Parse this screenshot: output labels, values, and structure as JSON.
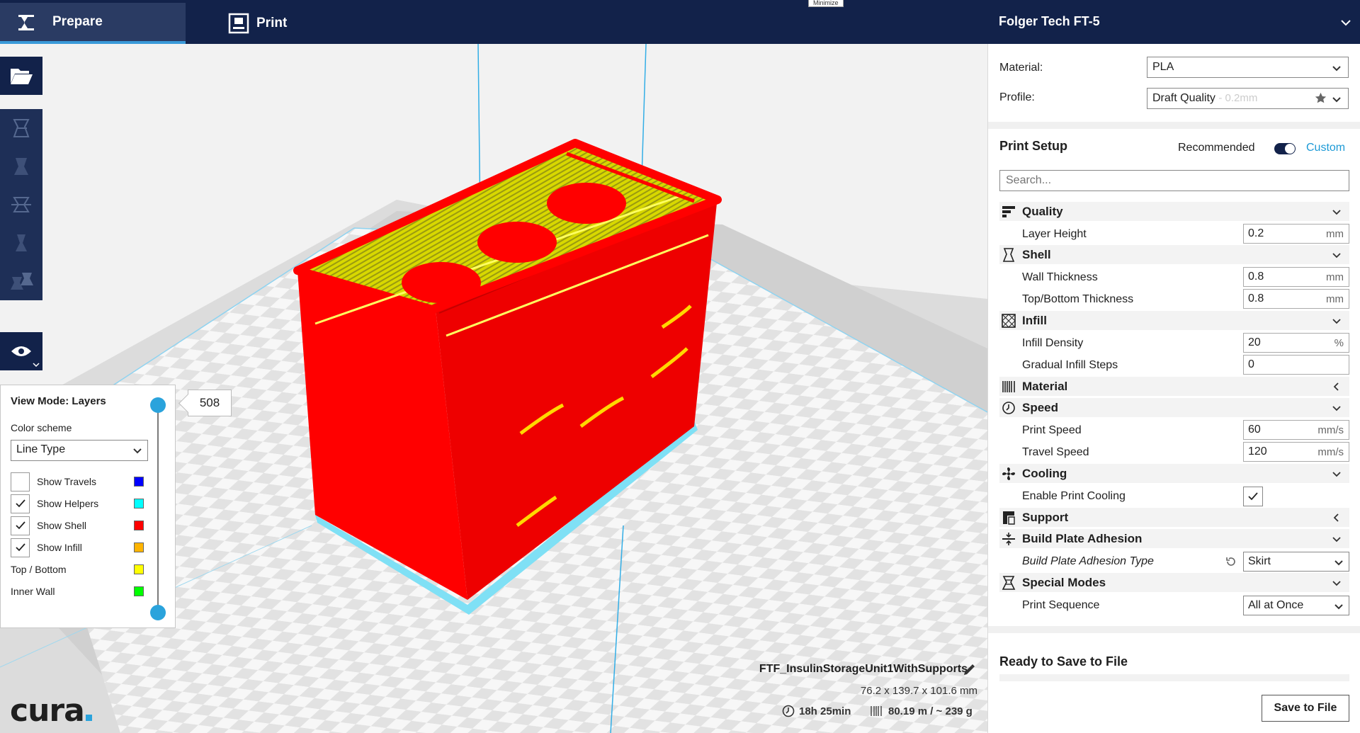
{
  "header": {
    "tabs": [
      {
        "label": "Prepare",
        "active": true
      },
      {
        "label": "Print",
        "active": false
      }
    ],
    "printer_name": "Folger Tech FT-5",
    "tooltip": "Minimize"
  },
  "toolbar": {
    "items": [
      "open-folder-icon",
      "move-tool-icon",
      "scale-tool-icon",
      "rotate-tool-icon",
      "mirror-tool-icon",
      "per-model-settings-icon",
      "view-mode-eye-icon"
    ]
  },
  "layer_view": {
    "title": "View Mode: Layers",
    "color_scheme_label": "Color scheme",
    "color_scheme_value": "Line Type",
    "current_layer": "508",
    "items": [
      {
        "label": "Show Travels",
        "checked": false,
        "color": "#0000ff"
      },
      {
        "label": "Show Helpers",
        "checked": true,
        "color": "#00ffff"
      },
      {
        "label": "Show Shell",
        "checked": true,
        "color": "#ff0000"
      },
      {
        "label": "Show Infill",
        "checked": true,
        "color": "#ffb400"
      },
      {
        "label": "Top / Bottom",
        "checked": null,
        "color": "#ffff00"
      },
      {
        "label": "Inner Wall",
        "checked": null,
        "color": "#00ff00"
      }
    ]
  },
  "job": {
    "name": "FTF_InsulinStorageUnit1WithSupports",
    "dimensions": "76.2 x 139.7 x 101.6 mm",
    "print_time": "18h 25min",
    "filament": "80.19 m / ~ 239 g"
  },
  "logo": "cura",
  "panel": {
    "material_label": "Material:",
    "material_value": "PLA",
    "profile_label": "Profile:",
    "profile_value": "Draft Quality",
    "profile_sub": "- 0.2mm",
    "print_setup_title": "Print Setup",
    "mode_recommended": "Recommended",
    "mode_custom": "Custom",
    "search_placeholder": "Search...",
    "categories": {
      "quality": "Quality",
      "shell": "Shell",
      "infill": "Infill",
      "material": "Material",
      "speed": "Speed",
      "cooling": "Cooling",
      "support": "Support",
      "adhesion": "Build Plate Adhesion",
      "special": "Special Modes"
    },
    "settings": {
      "layer_height": {
        "label": "Layer Height",
        "value": "0.2",
        "unit": "mm"
      },
      "wall_thickness": {
        "label": "Wall Thickness",
        "value": "0.8",
        "unit": "mm"
      },
      "topbottom_thickness": {
        "label": "Top/Bottom Thickness",
        "value": "0.8",
        "unit": "mm"
      },
      "infill_density": {
        "label": "Infill Density",
        "value": "20",
        "unit": "%"
      },
      "gradual_infill": {
        "label": "Gradual Infill Steps",
        "value": "0",
        "unit": ""
      },
      "print_speed": {
        "label": "Print Speed",
        "value": "60",
        "unit": "mm/s"
      },
      "travel_speed": {
        "label": "Travel Speed",
        "value": "120",
        "unit": "mm/s"
      },
      "enable_cooling": {
        "label": "Enable Print Cooling",
        "checked": true
      },
      "adhesion_type": {
        "label": "Build Plate Adhesion Type",
        "value": "Skirt"
      },
      "print_sequence": {
        "label": "Print Sequence",
        "value": "All at Once"
      }
    },
    "ready_text": "Ready to Save to File",
    "save_button": "Save to File"
  },
  "colors": {
    "header": "#12224a",
    "accent": "#2aa3dc",
    "model_red": "#ff0000",
    "model_top": "#c8c800"
  }
}
